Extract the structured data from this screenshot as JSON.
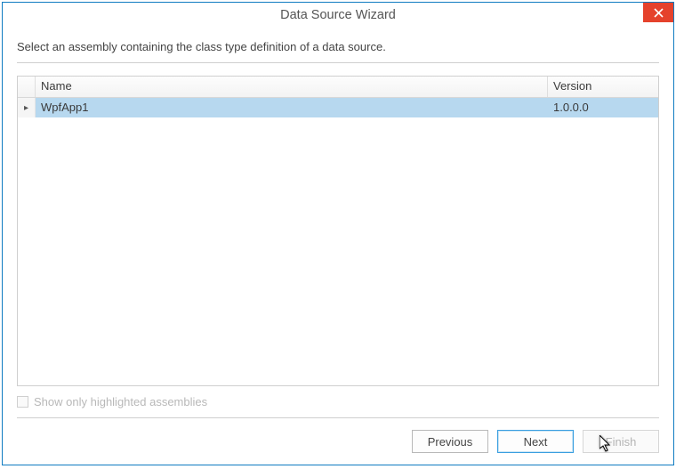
{
  "window": {
    "title": "Data Source Wizard"
  },
  "instruction": "Select an assembly containing the class type definition of a data source.",
  "grid": {
    "columns": {
      "name": "Name",
      "version": "Version"
    },
    "rows": [
      {
        "name": "WpfApp1",
        "version": "1.0.0.0",
        "selected": true
      }
    ]
  },
  "options": {
    "show_highlighted_label": "Show only highlighted assemblies",
    "show_highlighted_checked": false,
    "show_highlighted_enabled": false
  },
  "footer": {
    "previous": "Previous",
    "next": "Next",
    "finish": "Finish"
  }
}
